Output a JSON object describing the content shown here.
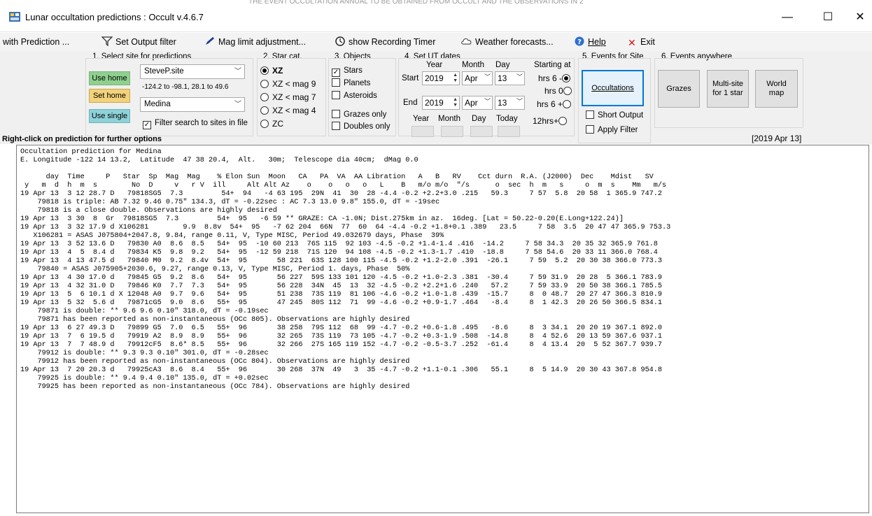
{
  "window": {
    "title": "Lunar occultation predictions : Occult v.4.6.7",
    "minimize": "—",
    "maximize": "☐",
    "close": "✕",
    "top_cut_text": "THE EVENT OCCULTATION ANNUAL  TO BE OBTAINED FROM OCCULT  AND THE OBSERVATIONS IN 2"
  },
  "menu": {
    "with_prediction": "with Prediction ...",
    "set_output_filter": "Set Output filter",
    "mag_limit": "Mag limit adjustment...",
    "recording_timer": "show Recording Timer",
    "weather": "Weather forecasts...",
    "help": "Help",
    "exit": "Exit"
  },
  "site": {
    "title": "1.  Select site for predictions",
    "use_home": "Use home",
    "set_home": "Set home",
    "use_single": "Use single",
    "site_file": "SteveP.site",
    "range": "-124.2 to -98.1, 28.1 to 49.6",
    "site_name": "Medina",
    "filter_label": "Filter search to sites in file",
    "filter_checked": "✓"
  },
  "starcat": {
    "title": "2. Star cat.",
    "xz": "XZ",
    "xz9": "XZ  < mag 9",
    "xz7": "XZ  < mag 7",
    "xz4": "XZ  < mag 4",
    "zc": "ZC"
  },
  "objects": {
    "title": "3. Objects",
    "stars": "Stars",
    "stars_checked": "✓",
    "planets": "Planets",
    "asteroids": "Asteroids",
    "grazes_only": "Grazes only",
    "doubles_only": "Doubles only"
  },
  "dates": {
    "title": "4.  Set UT dates",
    "year_hdr": "Year",
    "month_hdr": "Month",
    "day_hdr": "Day",
    "starting_at": "Starting at",
    "start_label": "Start",
    "end_label": "End",
    "start_year": "2019",
    "start_month": "Apr",
    "start_day": "13",
    "end_year": "2019",
    "end_month": "Apr",
    "end_day": "13",
    "opt_m6": "- 6 hrs",
    "opt_0": "0 hrs",
    "opt_p6": "+ 6 hrs",
    "opt_p12": "+12hrs",
    "bot_year": "Year",
    "bot_month": "Month",
    "bot_day": "Day",
    "bot_today": "Today"
  },
  "events_site": {
    "title": "5. Events for Site",
    "occultations": "Occultations",
    "short_output": "Short Output",
    "apply_filter": "Apply Filter"
  },
  "events_anywhere": {
    "title": "6.  Events anywhere",
    "grazes": "Grazes",
    "multisite": "Multi-site\nfor 1 star",
    "world_map": "World\nmap"
  },
  "hint": "Right-click on prediction for further options",
  "datestamp": "[2019 Apr 13]",
  "output_lines": [
    "Occultation prediction for Medina",
    "E. Longitude -122 14 13.2,  Latitude  47 38 20.4,  Alt.   30m;  Telescope dia 40cm;  dMag 0.0",
    "",
    "      day  Time     P   Star  Sp  Mag  Mag    % Elon Sun  Moon   CA   PA  VA  AA Libration   A   B   RV    Cct durn  R.A. (J2000)  Dec    Mdist   SV",
    " y   m  d  h  m  s        No  D     v   r V  ill     Alt Alt Az    o    o   o   o   L    B   m/o m/o  \"/s      o  sec  h  m   s     o  m  s    Mm   m/s",
    "19 Apr 13  3 12 28.7 D   79818SG5  7.3         54+  94   -4 63 195  29N  41  30  28 -4.4 -0.2 +2.2+3.0 .215   59.3     7 57  5.8  20 58  1 365.9 747.2",
    "    79818 is triple: AB 7.32 9.46 0.75\" 134.3, dT = -0.22sec : AC 7.3 13.0 9.8\" 155.0, dT = -19sec",
    "    79818 is a close double. Observations are highly desired",
    "19 Apr 13  3 30  8  Gr  79818SG5  7.3         54+  95   -6 59 ** GRAZE: CA -1.0N; Dist.275km in az.  16deg. [Lat = 50.22-0.20(E.Long+122.24)]",
    "19 Apr 13  3 32 17.9 d X106281        9.9  8.8v  54+  95   -7 62 204  66N  77  60  64 -4.4 -0.2 +1.8+0.1 .389   23.5     7 58  3.5  20 47 47 365.9 753.3",
    "   X106281 = ASAS J075804+2047.8, 9.84, range 0.11, V, Type MISC, Period 49.032679 days, Phase  39%",
    "19 Apr 13  3 52 13.6 D   79830 A0  8.6  8.5   54+  95  -10 60 213  76S 115  92 103 -4.5 -0.2 +1.4-1.4 .416  -14.2     7 58 34.3  20 35 32 365.9 761.8",
    "19 Apr 13  4  5  8.4 d   79834 K5  9.8  9.2   54+  95  -12 59 218  71S 120  94 108 -4.5 -0.2 +1.3-1.7 .410  -18.8     7 58 54.6  20 33 11 366.0 768.4",
    "19 Apr 13  4 13 47.5 d   79840 M0  9.2  8.4v  54+  95       58 221  63S 128 100 115 -4.5 -0.2 +1.2-2.0 .391  -26.1     7 59  5.2  20 30 38 366.0 773.3",
    "    79840 = ASAS J075905+2030.6, 9.27, range 0.13, V, Type MISC, Period 1. days, Phase  50%",
    "19 Apr 13  4 30 17.0 d   79845 G5  9.2  8.6   54+  95       56 227  59S 133 101 120 -4.5 -0.2 +1.0-2.3 .381  -30.4     7 59 31.9  20 28  5 366.1 783.9",
    "19 Apr 13  4 32 31.0 D   79846 K0  7.7  7.3   54+  95       56 228  34N  45  13  32 -4.5 -0.2 +2.2+1.6 .240   57.2     7 59 33.9  20 50 38 366.1 785.5",
    "19 Apr 13  5  6 10.1 d X 12048 A0  9.7  9.6   54+  95       51 238  73S 119  81 106 -4.6 -0.2 +1.0-1.8 .439  -15.7     8  0 48.7  20 27 47 366.3 810.9",
    "19 Apr 13  5 32  5.6 d   79871cG5  9.0  8.6   55+  95       47 245  80S 112  71  99 -4.6 -0.2 +0.9-1.7 .464   -8.4     8  1 42.3  20 26 50 366.5 834.1",
    "    79871 is double: ** 9.6 9.6 0.10\" 318.0, dT = -0.19sec",
    "    79871 has been reported as non-instantaneous (OCc 805). Observations are highly desired",
    "19 Apr 13  6 27 49.3 D   79899 G5  7.0  6.5   55+  96       38 258  79S 112  68  99 -4.7 -0.2 +0.6-1.8 .495   -8.6     8  3 34.1  20 20 19 367.1 892.0",
    "19 Apr 13  7  6 19.5 d   79919 A2  8.9  8.9   55+  96       32 265  73S 119  73 105 -4.7 -0.2 +0.3-1.9 .508  -14.8     8  4 52.6  20 13 59 367.6 937.1",
    "19 Apr 13  7  7 48.9 d   79912cF5  8.6* 8.5   55+  96       32 266  27S 165 119 152 -4.7 -0.2 -0.5-3.7 .252  -61.4     8  4 13.4  20  5 52 367.7 939.7",
    "    79912 is double: ** 9.3 9.3 0.10\" 301.0, dT = -0.28sec",
    "    79912 has been reported as non-instantaneous (OCc 804). Observations are highly desired",
    "19 Apr 13  7 20 20.3 d   79925cA3  8.6  8.4   55+  96       30 268  37N  49   3  35 -4.7 -0.2 +1.1-0.1 .306   55.1     8  5 14.9  20 30 43 367.8 954.8",
    "    79925 is double: ** 9.4 9.4 0.10\" 135.0, dT = +0.02sec",
    "    79925 has been reported as non-instantaneous (OCc 784). Observations are highly desired"
  ]
}
